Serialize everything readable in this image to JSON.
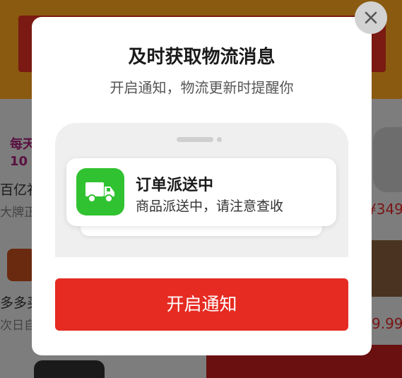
{
  "background": {
    "promo_text_1": "每天",
    "promo_text_2": "10",
    "item1_title": "百亿补",
    "item1_sub": "大牌正",
    "item1_price": "¥349",
    "item2_title": "多多买",
    "item2_sub": "次日自",
    "item2_price": "9.99"
  },
  "modal": {
    "title": "及时获取物流消息",
    "subtitle": "开启通知，物流更新时提醒你",
    "notification": {
      "title": "订单派送中",
      "body": "商品派送中，请注意查收"
    },
    "cta_label": "开启通知"
  },
  "colors": {
    "accent": "#e52b22",
    "app_icon": "#31c231"
  },
  "icons": {
    "close": "close-icon",
    "truck": "truck-icon"
  }
}
